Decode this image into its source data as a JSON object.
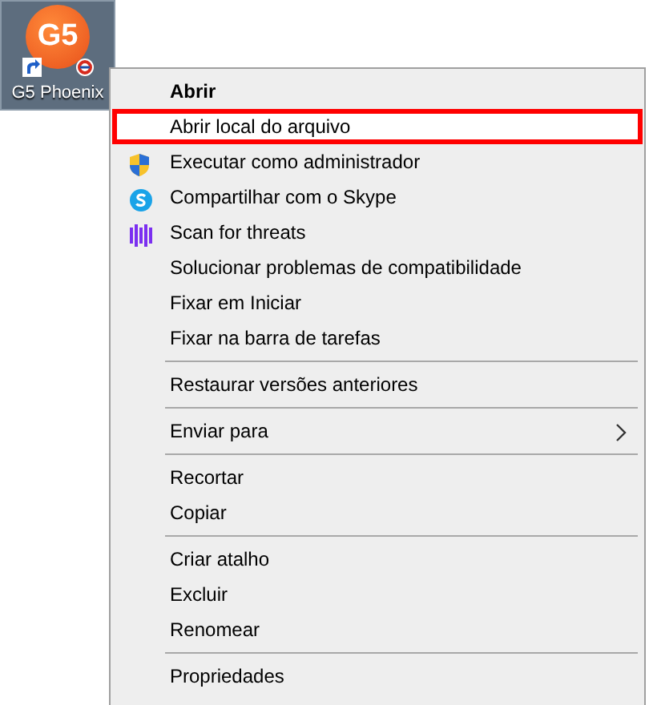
{
  "desktop_icon": {
    "label": "G5 Phoenix",
    "logo_text": "G5",
    "selected": true
  },
  "context_menu": {
    "groups": [
      [
        {
          "kind": "plain",
          "label": "Abrir",
          "default": true,
          "selected": false,
          "submenu": false
        },
        {
          "kind": "plain",
          "label": "Abrir local do arquivo",
          "default": false,
          "selected": true,
          "submenu": false
        },
        {
          "kind": "shield",
          "label": "Executar como administrador",
          "default": false,
          "selected": false,
          "submenu": false
        },
        {
          "kind": "skype",
          "label": "Compartilhar com o Skype",
          "default": false,
          "selected": false,
          "submenu": false
        },
        {
          "kind": "scan",
          "label": "Scan for threats",
          "default": false,
          "selected": false,
          "submenu": false
        },
        {
          "kind": "plain",
          "label": "Solucionar problemas de compatibilidade",
          "default": false,
          "selected": false,
          "submenu": false
        },
        {
          "kind": "plain",
          "label": "Fixar em Iniciar",
          "default": false,
          "selected": false,
          "submenu": false
        },
        {
          "kind": "plain",
          "label": "Fixar na barra de tarefas",
          "default": false,
          "selected": false,
          "submenu": false
        }
      ],
      [
        {
          "kind": "plain",
          "label": "Restaurar versões anteriores",
          "default": false,
          "selected": false,
          "submenu": false
        }
      ],
      [
        {
          "kind": "plain",
          "label": "Enviar para",
          "default": false,
          "selected": false,
          "submenu": true
        }
      ],
      [
        {
          "kind": "plain",
          "label": "Recortar",
          "default": false,
          "selected": false,
          "submenu": false
        },
        {
          "kind": "plain",
          "label": "Copiar",
          "default": false,
          "selected": false,
          "submenu": false
        }
      ],
      [
        {
          "kind": "plain",
          "label": "Criar atalho",
          "default": false,
          "selected": false,
          "submenu": false
        },
        {
          "kind": "plain",
          "label": "Excluir",
          "default": false,
          "selected": false,
          "submenu": false
        },
        {
          "kind": "plain",
          "label": "Renomear",
          "default": false,
          "selected": false,
          "submenu": false
        }
      ],
      [
        {
          "kind": "plain",
          "label": "Propriedades",
          "default": false,
          "selected": false,
          "submenu": false
        }
      ]
    ]
  }
}
